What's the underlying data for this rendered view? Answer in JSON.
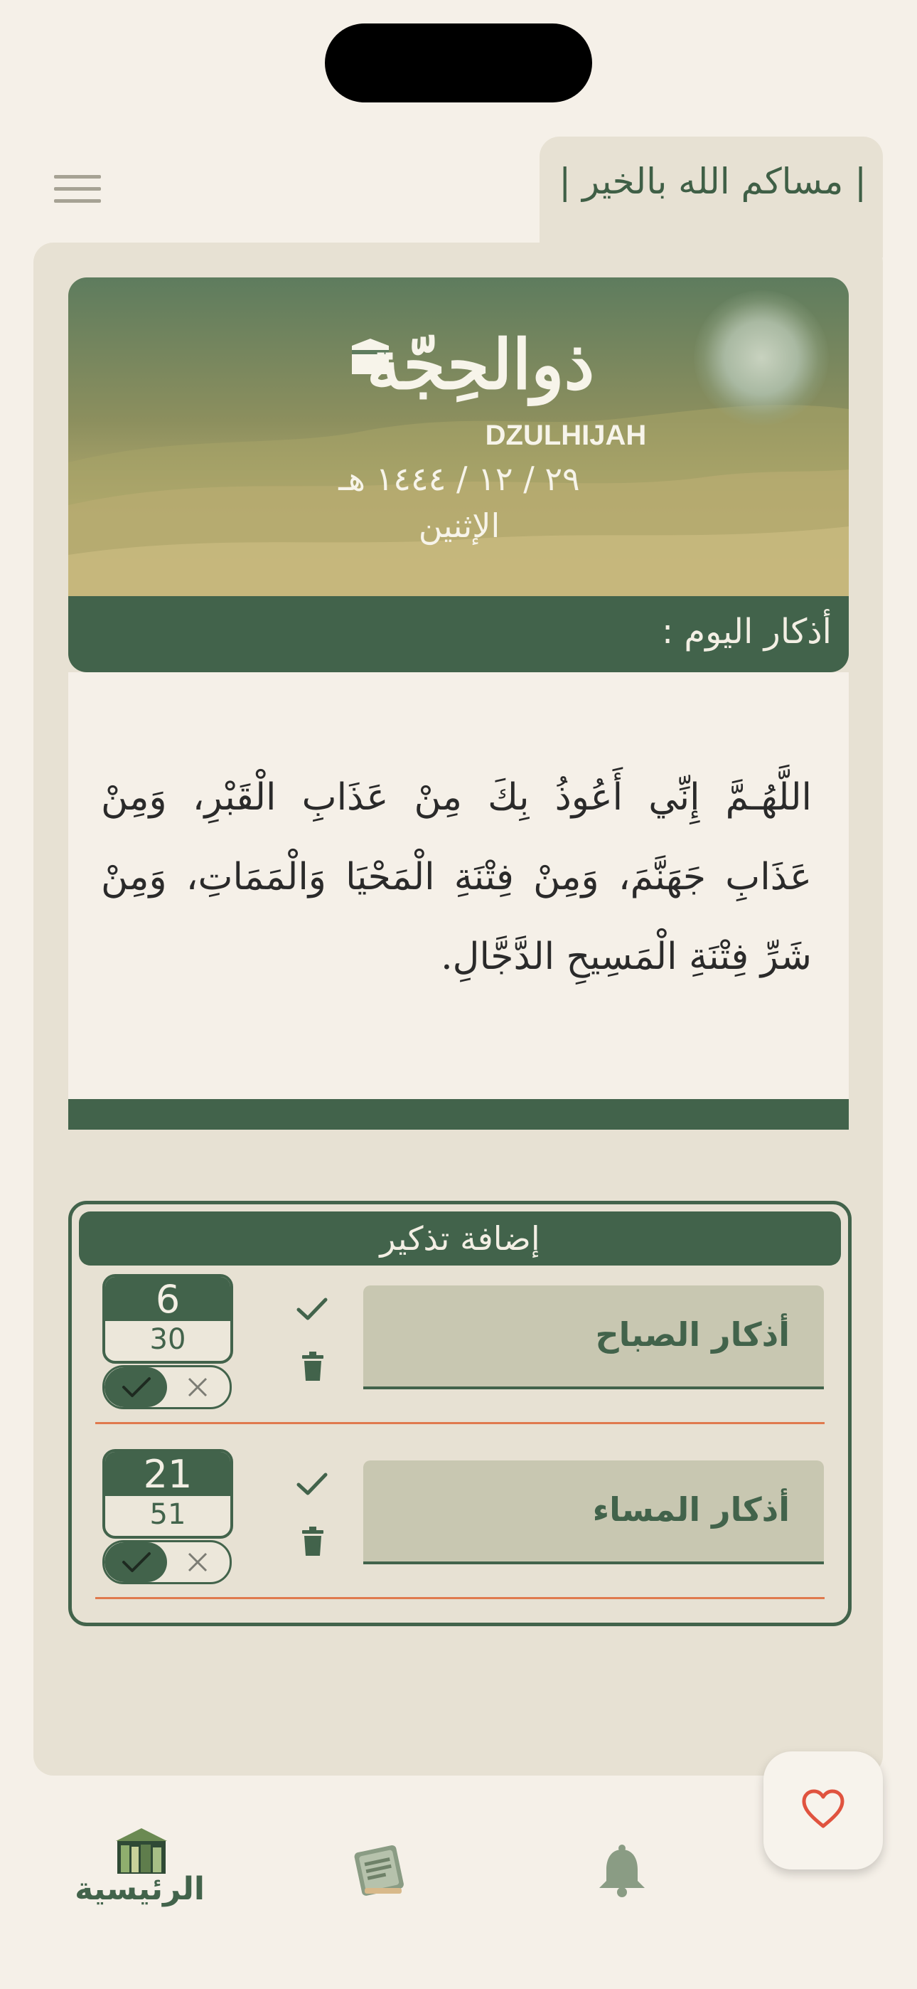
{
  "greeting": "| مساكم الله بالخير |",
  "hijri_banner": {
    "month_ar": "ذوالحِجّة",
    "month_en": "DZULHIJAH",
    "date": "٢٩ / ١٢ / ١٤٤٤ هـ",
    "day": "الإثنين"
  },
  "daily_adhkar": {
    "title": "أذكار اليوم :",
    "text": "اللَّهُـمَّ إِنِّي أَعُوذُ بِكَ مِنْ عَذَابِ الْقَبْرِ، وَمِنْ عَذَابِ جَهَنَّمَ، وَمِنْ فِتْنَةِ الْمَحْيَا وَالْمَمَاتِ، وَمِنْ شَرِّ فِتْنَةِ الْمَسِيحِ الدَّجَّالِ."
  },
  "reminders": {
    "add_label": "إضافة تذكير",
    "items": [
      {
        "name": "أذكار الصباح",
        "minute": "6",
        "second": "30",
        "enabled": true
      },
      {
        "name": "أذكار المساء",
        "minute": "21",
        "second": "51",
        "enabled": true
      }
    ]
  },
  "nav": {
    "home_label": "الرئيسية",
    "items": [
      "home-icon",
      "book-icon",
      "bell-icon"
    ]
  },
  "fab_icon": "heart-icon",
  "colors": {
    "primary": "#42634b",
    "background": "#f5f0e8",
    "panel": "#e7e1d3",
    "accent": "#e07a4e"
  }
}
